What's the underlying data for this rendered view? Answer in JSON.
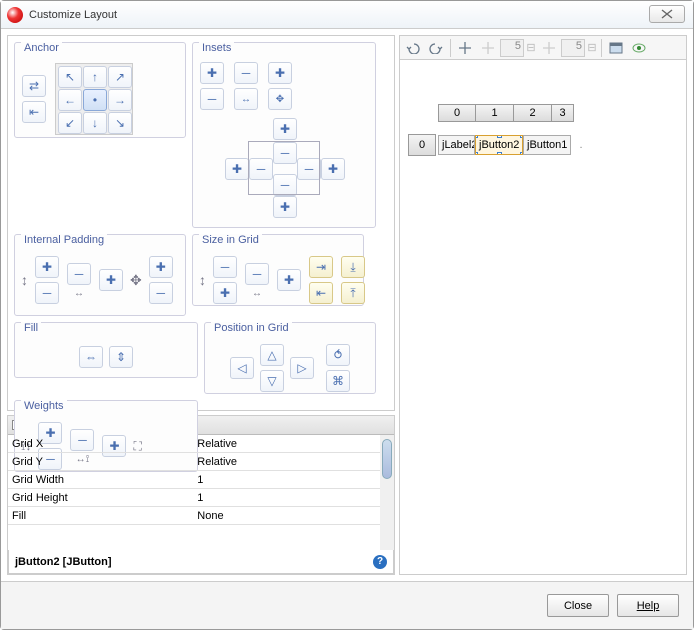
{
  "window": {
    "title": "Customize Layout"
  },
  "groups": {
    "anchor": "Anchor",
    "internal_padding": "Internal Padding",
    "size_in_grid": "Size in Grid",
    "insets": "Insets",
    "fill": "Fill",
    "weights": "Weights",
    "position_in_grid": "Position in Grid"
  },
  "toolbar": {
    "undo": "undo-icon",
    "redo": "redo-icon",
    "grid_on": "grid-icon",
    "grid_off": "grid-off-icon",
    "spin1": "5",
    "spin2": "5",
    "window_icon": "window-icon",
    "eye_icon": "eye-icon"
  },
  "preview": {
    "columns": [
      "0",
      "1",
      "2",
      "3"
    ],
    "rows": [
      "0"
    ],
    "components": [
      {
        "name": "jLabel2",
        "selected": false
      },
      {
        "name": "jButton2",
        "selected": true
      },
      {
        "name": "jButton1",
        "selected": false
      }
    ],
    "trailing_gap": "."
  },
  "constraints": {
    "header": "Layout Constraints",
    "rows": [
      {
        "k": "Grid X",
        "v": "Relative"
      },
      {
        "k": "Grid Y",
        "v": "Relative"
      },
      {
        "k": "Grid Width",
        "v": "1"
      },
      {
        "k": "Grid Height",
        "v": "1"
      },
      {
        "k": "Fill",
        "v": "None"
      }
    ]
  },
  "status": {
    "text": "jButton2 [JButton]"
  },
  "footer": {
    "close": "Close",
    "help": "Help"
  }
}
